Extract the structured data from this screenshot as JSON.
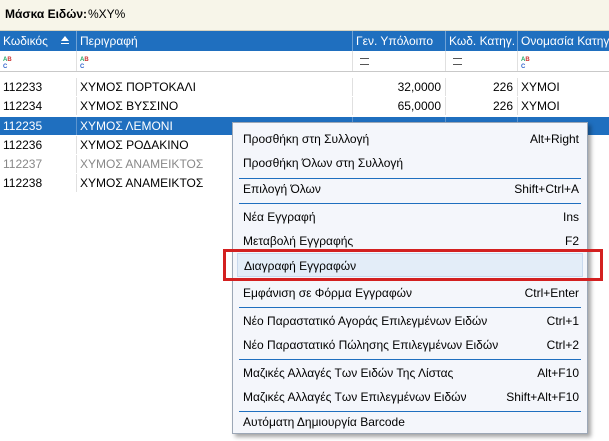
{
  "mask": {
    "label": "Μάσκα Ειδών:",
    "value": "%ΧΥ%"
  },
  "columns": [
    {
      "name": "col-code",
      "label": "Κωδικός"
    },
    {
      "name": "col-description",
      "label": "Περιγραφή"
    },
    {
      "name": "col-balance",
      "label": "Γεν. Υπόλοιπο"
    },
    {
      "name": "col-category-code",
      "label": "Κωδ. Κατηγ."
    },
    {
      "name": "col-category-name",
      "label": "Ονομασία Κατηγ"
    }
  ],
  "filter_icons": [
    "abc-filter-icon",
    "abc-filter-icon",
    "equals-filter-icon",
    "equals-filter-icon",
    "abc-filter-icon"
  ],
  "rows": [
    {
      "code": "112233",
      "description": "ΧΥΜΟΣ ΠΟΡΤΟΚΑΛΙ",
      "balance": "32,0000",
      "category_code": "226",
      "category_name": "ΧΥΜΟΙ",
      "state": "normal"
    },
    {
      "code": "112234",
      "description": "ΧΥΜΟΣ ΒΥΣΣΙΝΟ",
      "balance": "65,0000",
      "category_code": "226",
      "category_name": "ΧΥΜΟΙ",
      "state": "normal"
    },
    {
      "code": "112235",
      "description": "ΧΥΜΟΣ ΛΕΜΟΝΙ",
      "balance": "",
      "category_code": "",
      "category_name": "",
      "state": "selected"
    },
    {
      "code": "112236",
      "description": "ΧΥΜΟΣ ΡΟΔΑΚΙΝΟ",
      "balance": "",
      "category_code": "",
      "category_name": "",
      "state": "normal"
    },
    {
      "code": "112237",
      "description": "ΧΥΜΟΣ ΑΝΑΜΕΙΚΤΟΣ",
      "balance": "",
      "category_code": "",
      "category_name": "",
      "state": "gray"
    },
    {
      "code": "112238",
      "description": "ΧΥΜΟΣ ΑΝΑΜΕΙΚΤΟΣ",
      "balance": "",
      "category_code": "",
      "category_name": "",
      "state": "normal"
    }
  ],
  "context_menu": {
    "items": [
      {
        "label": "Προσθήκη στη Συλλογή",
        "shortcut": "Alt+Right"
      },
      {
        "label": "Προσθήκη Όλων στη Συλλογή",
        "shortcut": ""
      },
      {
        "label": "Επιλογή Όλων",
        "shortcut": "Shift+Ctrl+A"
      },
      {
        "label": "Νέα Εγγραφή",
        "shortcut": "Ins"
      },
      {
        "label": "Μεταβολή Εγγραφής",
        "shortcut": "F2"
      },
      {
        "label": "Διαγραφή Εγγραφών",
        "shortcut": ""
      },
      {
        "label": "Εμφάνιση σε Φόρμα Εγγραφών",
        "shortcut": "Ctrl+Enter"
      },
      {
        "label": "Νέο Παραστατικό Αγοράς Επιλεγμένων Ειδών",
        "shortcut": "Ctrl+1"
      },
      {
        "label": "Νέο Παραστατικό Πώλησης Επιλεγμένων Ειδών",
        "shortcut": "Ctrl+2"
      },
      {
        "label": "Μαζικές Αλλαγές Των Ειδών Της Λίστας",
        "shortcut": "Alt+F10"
      },
      {
        "label": "Μαζικές Αλλαγές Των Επιλεγμένων Ειδών",
        "shortcut": "Shift+Alt+F10"
      },
      {
        "label": "Αυτόματη Δημιουργία Barcode",
        "shortcut": ""
      }
    ],
    "highlighted_item": "Διαγραφή Εγγραφών"
  },
  "colors": {
    "header_bg": "#1f6fbf",
    "selected_row_bg": "#1f6fbf",
    "highlight_box": "#d32020",
    "menu_bg": "#f4f6fb"
  }
}
